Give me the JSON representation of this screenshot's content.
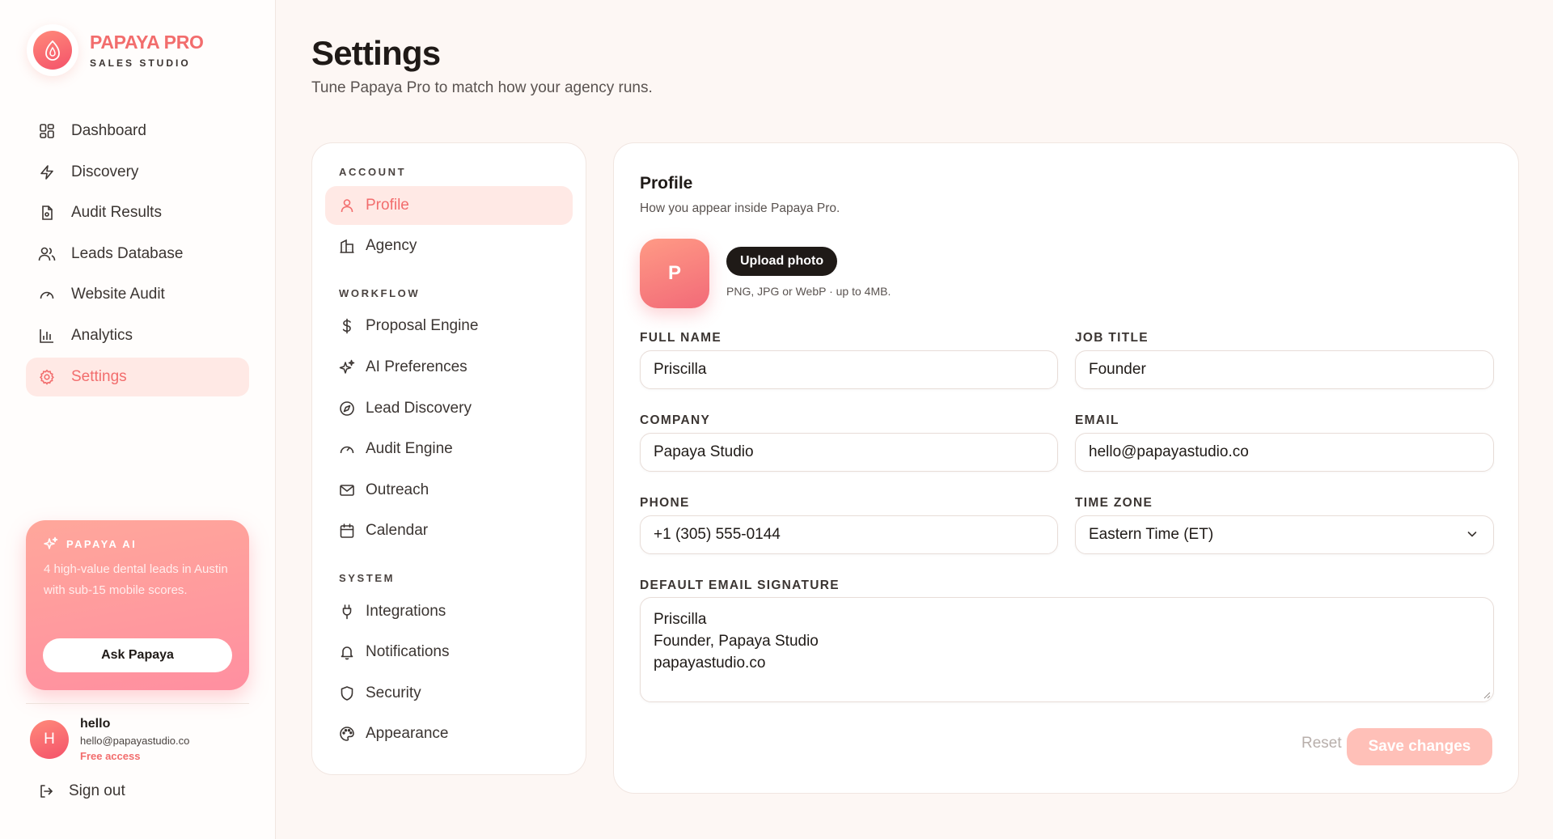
{
  "brand": {
    "name": "PAPAYA PRO",
    "subtitle": "SALES STUDIO"
  },
  "sidebar": {
    "items": [
      {
        "label": "Dashboard",
        "icon": "grid-icon"
      },
      {
        "label": "Discovery",
        "icon": "lightning-icon"
      },
      {
        "label": "Audit Results",
        "icon": "document-icon"
      },
      {
        "label": "Leads Database",
        "icon": "users-icon"
      },
      {
        "label": "Website Audit",
        "icon": "gauge-icon"
      },
      {
        "label": "Analytics",
        "icon": "bar-chart-icon"
      },
      {
        "label": "Settings",
        "icon": "gear-icon",
        "active": true
      }
    ]
  },
  "ai_card": {
    "title": "PAPAYA AI",
    "text": "4 high-value dental leads in Austin with sub-15 mobile scores.",
    "button": "Ask Papaya"
  },
  "user": {
    "initial": "H",
    "name": "hello",
    "email": "hello@papayastudio.co",
    "plan": "Free access"
  },
  "signout": "Sign out",
  "header": {
    "title": "Settings",
    "subtitle": "Tune Papaya Pro to match how your agency runs."
  },
  "settings_nav": {
    "account_label": "ACCOUNT",
    "account": [
      {
        "label": "Profile",
        "icon": "user-icon",
        "active": true
      },
      {
        "label": "Agency",
        "icon": "building-icon"
      }
    ],
    "workflow_label": "WORKFLOW",
    "workflow": [
      {
        "label": "Proposal Engine",
        "icon": "dollar-icon"
      },
      {
        "label": "AI Preferences",
        "icon": "sparkles-icon"
      },
      {
        "label": "Lead Discovery",
        "icon": "compass-icon"
      },
      {
        "label": "Audit Engine",
        "icon": "gauge-icon"
      },
      {
        "label": "Outreach",
        "icon": "mail-icon"
      },
      {
        "label": "Calendar",
        "icon": "calendar-icon"
      }
    ],
    "system_label": "SYSTEM",
    "system": [
      {
        "label": "Integrations",
        "icon": "plug-icon"
      },
      {
        "label": "Notifications",
        "icon": "bell-icon"
      },
      {
        "label": "Security",
        "icon": "shield-icon"
      },
      {
        "label": "Appearance",
        "icon": "palette-icon"
      }
    ]
  },
  "profile": {
    "title": "Profile",
    "subtitle": "How you appear inside Papaya Pro.",
    "avatar_initial": "P",
    "upload_label": "Upload photo",
    "upload_hint": "PNG, JPG or WebP · up to 4MB.",
    "fields": {
      "full_name": {
        "label": "FULL NAME",
        "value": "Priscilla"
      },
      "job_title": {
        "label": "JOB TITLE",
        "value": "Founder"
      },
      "company": {
        "label": "COMPANY",
        "value": "Papaya Studio"
      },
      "email": {
        "label": "EMAIL",
        "value": "hello@papayastudio.co"
      },
      "phone": {
        "label": "PHONE",
        "value": "+1 (305) 555-0144"
      },
      "time_zone": {
        "label": "TIME ZONE",
        "value": "Eastern Time (ET)"
      },
      "signature": {
        "label": "DEFAULT EMAIL SIGNATURE",
        "lines": [
          "Priscilla",
          "Founder, Papaya Studio",
          "papayastudio.co"
        ]
      }
    },
    "reset_label": "Reset",
    "save_label": "Save changes"
  },
  "colors": {
    "accent": "#f26d6d",
    "active_bg": "#ffe9e5",
    "dark": "#1f1a17"
  }
}
